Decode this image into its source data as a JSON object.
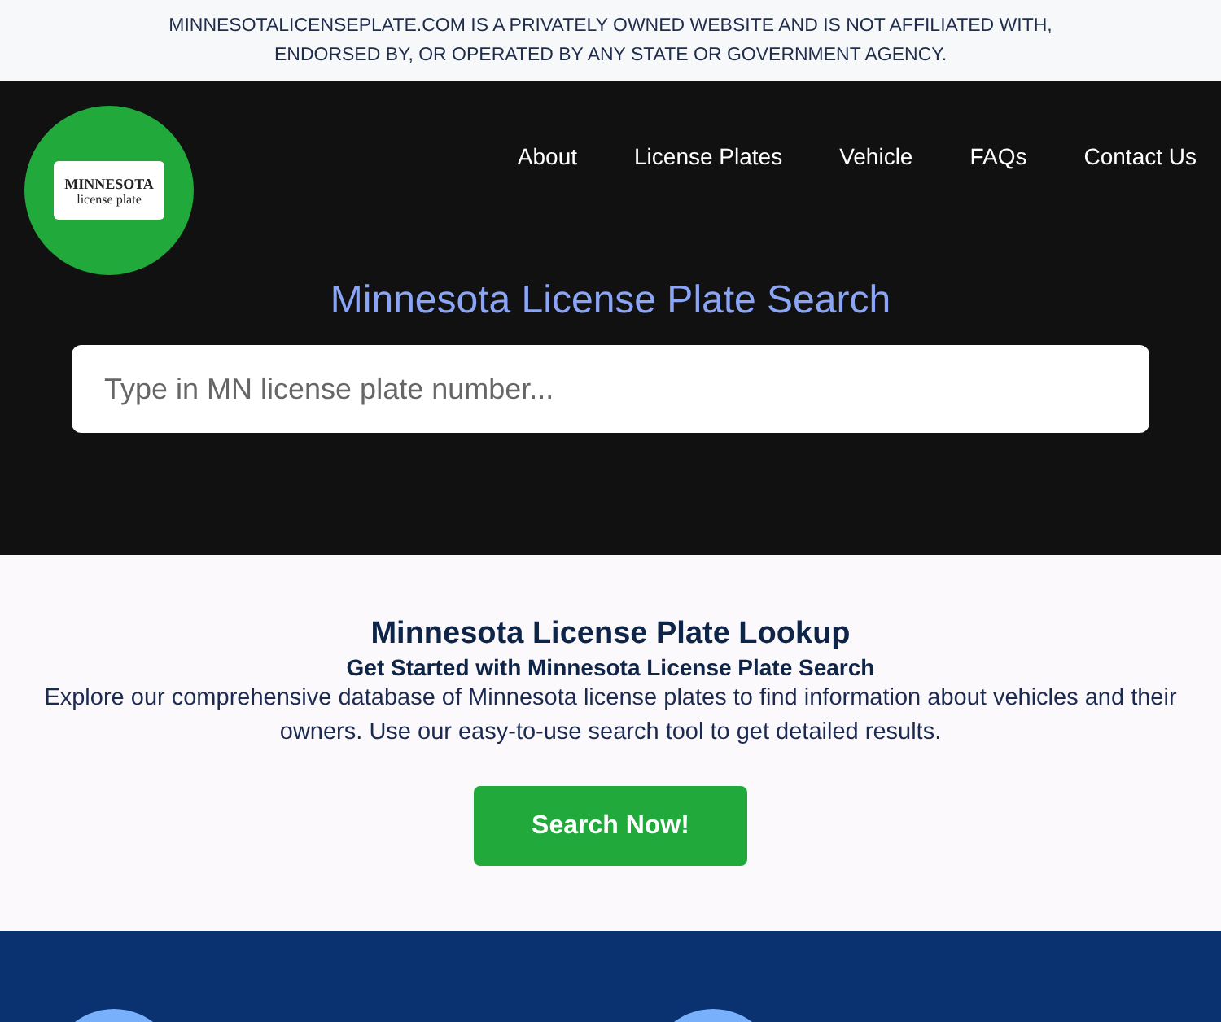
{
  "disclaimer": "MINNESOTALICENSEPLATE.COM IS A PRIVATELY OWNED WEBSITE AND IS NOT AFFILIATED WITH, ENDORSED BY, OR OPERATED BY ANY STATE OR GOVERNMENT AGENCY.",
  "logo": {
    "line_1": "MINNESOTA",
    "line_2": "license plate"
  },
  "nav": [
    {
      "label": "About"
    },
    {
      "label": "License Plates"
    },
    {
      "label": "Vehicle"
    },
    {
      "label": "FAQs"
    },
    {
      "label": "Contact Us"
    }
  ],
  "hero": {
    "title": "Minnesota License Plate Search",
    "search": {
      "placeholder": "Type in MN license plate number..."
    }
  },
  "intro": {
    "heading": "Minnesota License Plate Lookup",
    "subheading": "Get Started with Minnesota License Plate Search",
    "text": "Explore our comprehensive database of Minnesota license plates to find information about vehicles and their owners. Use our easy-to-use search tool to get detailed results.",
    "button": "Search Now!"
  }
}
